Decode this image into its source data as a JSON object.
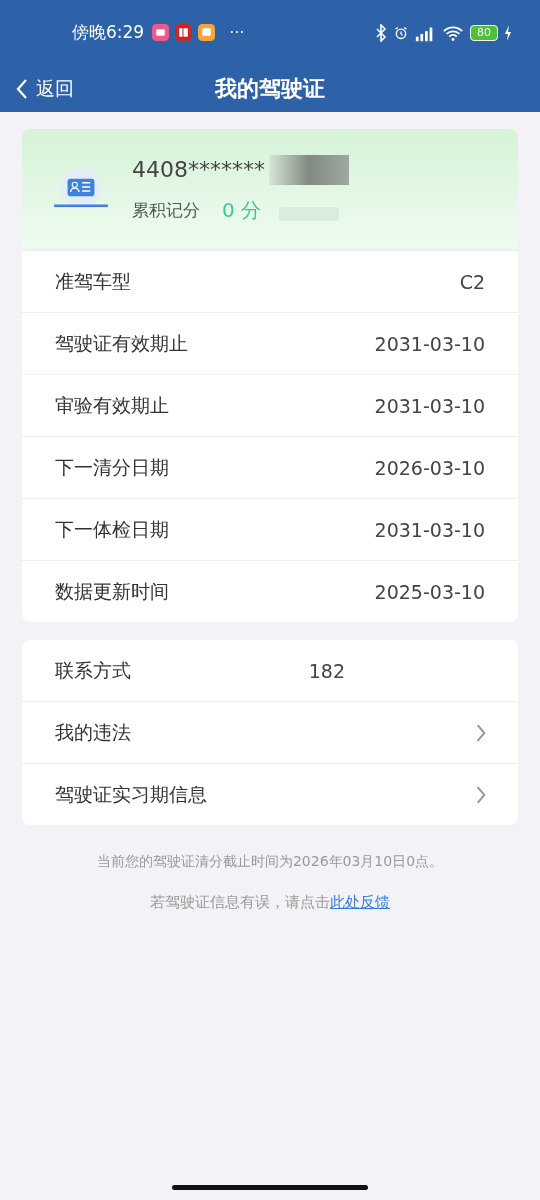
{
  "status_bar": {
    "time": "傍晚6:29",
    "more": "···",
    "battery": "80"
  },
  "nav": {
    "back": "返回",
    "title": "我的驾驶证"
  },
  "license": {
    "number": "4408*******",
    "points_label": "累积记分",
    "points": "0 分"
  },
  "details": [
    {
      "label": "准驾车型",
      "value": "C2"
    },
    {
      "label": "驾驶证有效期止",
      "value": "2031-03-10"
    },
    {
      "label": "审验有效期止",
      "value": "2031-03-10"
    },
    {
      "label": "下一清分日期",
      "value": "2026-03-10"
    },
    {
      "label": "下一体检日期",
      "value": "2031-03-10"
    },
    {
      "label": "数据更新时间",
      "value": "2025-03-10"
    }
  ],
  "links": [
    {
      "kind": "value",
      "label": "联系方式",
      "value": "182"
    },
    {
      "kind": "arrow",
      "label": "我的违法"
    },
    {
      "kind": "arrow",
      "label": "驾驶证实习期信息"
    }
  ],
  "note": "当前您的驾驶证清分截止时间为2026年03月10日0点。",
  "feedback": {
    "text": "若驾驶证信息有误，请点击",
    "link": "此处反馈"
  }
}
